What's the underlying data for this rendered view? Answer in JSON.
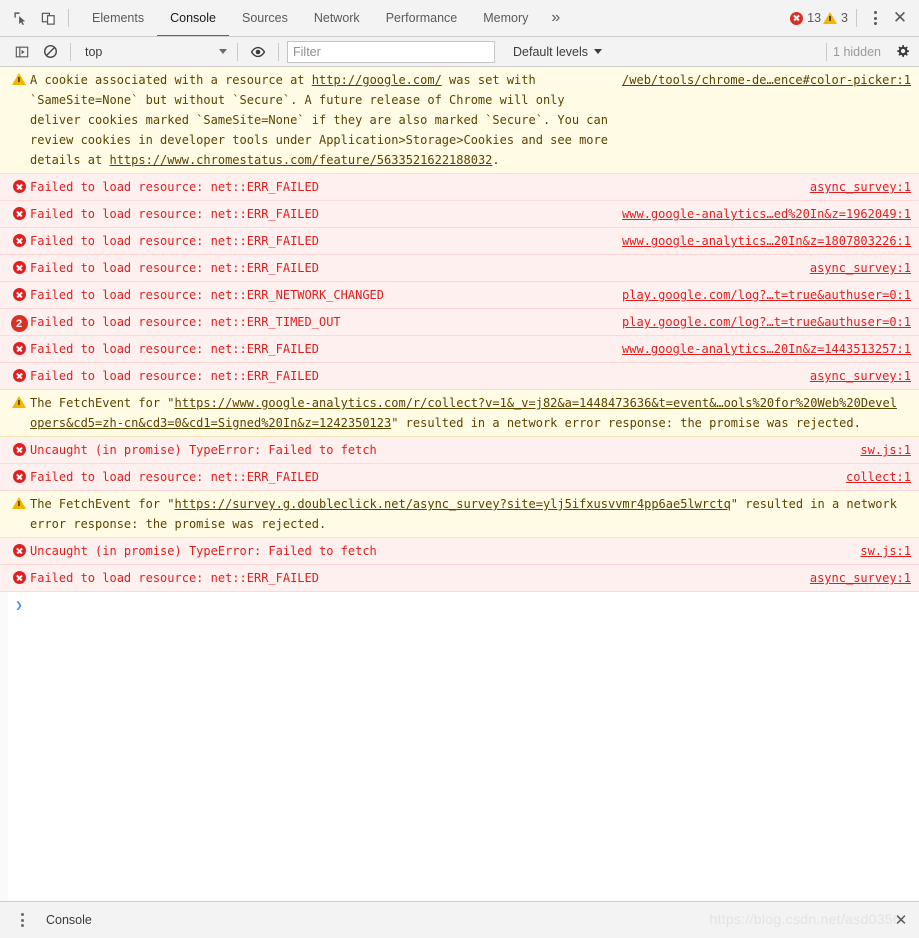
{
  "window": {
    "title": "Chrome DevTools — Console"
  },
  "tabbar": {
    "inspect_icon": "inspect-cursor-icon",
    "device_icon": "device-toolbar-icon",
    "tabs": [
      {
        "label": "Elements",
        "selected": false
      },
      {
        "label": "Console",
        "selected": true
      },
      {
        "label": "Sources",
        "selected": false
      },
      {
        "label": "Network",
        "selected": false
      },
      {
        "label": "Performance",
        "selected": false
      },
      {
        "label": "Memory",
        "selected": false
      }
    ],
    "more_tabs_label": "»",
    "error_count": "13",
    "warning_count": "3",
    "kebab_label": "customize-and-control",
    "close_label": "✕"
  },
  "toolbar": {
    "sidebar_toggle_icon": "console-sidebar-icon",
    "clear_icon": "clear-console-icon",
    "context": "top",
    "context_options": [
      "top"
    ],
    "eye_icon": "create-live-expression-icon",
    "filter_value": "",
    "filter_placeholder": "Filter",
    "levels_label": "Default levels",
    "hidden_label": "1 hidden",
    "settings_icon": "gear-icon"
  },
  "console": {
    "messages": [
      {
        "level": "warn",
        "icon": "warning-icon",
        "count": null,
        "text_parts": [
          {
            "t": "A cookie associated with a resource at ",
            "link": false
          },
          {
            "t": "http://google.com/",
            "link": true
          },
          {
            "t": " was set with `SameSite=None` but without `Secure`. A future release of Chrome will only deliver cookies marked `SameSite=None` if they are also marked `Secure`. You can review cookies in developer tools under Application>Storage>Cookies and see more details at ",
            "link": false
          },
          {
            "t": "https://www.chromestatus.com/feature/5633521622188032",
            "link": true
          },
          {
            "t": ".",
            "link": false
          }
        ],
        "source": "/web/tools/chrome-de…ence#color-picker:1"
      },
      {
        "level": "error",
        "icon": "error-icon",
        "count": null,
        "text_parts": [
          {
            "t": "Failed to load resource: net::ERR_FAILED",
            "link": false
          }
        ],
        "source": "async_survey:1"
      },
      {
        "level": "error",
        "icon": "error-icon",
        "count": null,
        "text_parts": [
          {
            "t": "Failed to load resource: net::ERR_FAILED",
            "link": false
          }
        ],
        "source": "www.google-analytics…ed%20In&z=1962049:1"
      },
      {
        "level": "error",
        "icon": "error-icon",
        "count": null,
        "text_parts": [
          {
            "t": "Failed to load resource: net::ERR_FAILED",
            "link": false
          }
        ],
        "source": "www.google-analytics…20In&z=1807803226:1"
      },
      {
        "level": "error",
        "icon": "error-icon",
        "count": null,
        "text_parts": [
          {
            "t": "Failed to load resource: net::ERR_FAILED",
            "link": false
          }
        ],
        "source": "async_survey:1"
      },
      {
        "level": "error",
        "icon": "error-icon",
        "count": null,
        "text_parts": [
          {
            "t": "Failed to load resource: net::ERR_NETWORK_CHANGED",
            "link": false
          }
        ],
        "source": "play.google.com/log?…t=true&authuser=0:1"
      },
      {
        "level": "error",
        "icon": "count-badge",
        "count": "2",
        "text_parts": [
          {
            "t": "Failed to load resource: net::ERR_TIMED_OUT",
            "link": false
          }
        ],
        "source": "play.google.com/log?…t=true&authuser=0:1"
      },
      {
        "level": "error",
        "icon": "error-icon",
        "count": null,
        "text_parts": [
          {
            "t": "Failed to load resource: net::ERR_FAILED",
            "link": false
          }
        ],
        "source": "www.google-analytics…20In&z=1443513257:1"
      },
      {
        "level": "error",
        "icon": "error-icon",
        "count": null,
        "text_parts": [
          {
            "t": "Failed to load resource: net::ERR_FAILED",
            "link": false
          }
        ],
        "source": "async_survey:1"
      },
      {
        "level": "warn",
        "icon": "warning-icon",
        "count": null,
        "text_parts": [
          {
            "t": "The FetchEvent for \"",
            "link": false
          },
          {
            "t": "https://www.google-analytics.com/r/collect?v=1&_v=j82&a=1448473636&t=event&…ools%20for%20Web%20Developers&cd5=zh-cn&cd3=0&cd1=Signed%20In&z=1242350123",
            "link": true
          },
          {
            "t": "\" resulted in a network error response: the promise was rejected.",
            "link": false
          }
        ],
        "source": ""
      },
      {
        "level": "error",
        "icon": "error-icon",
        "count": null,
        "text_parts": [
          {
            "t": "Uncaught (in promise) TypeError: Failed to fetch",
            "link": false
          }
        ],
        "source": "sw.js:1"
      },
      {
        "level": "error",
        "icon": "error-icon",
        "count": null,
        "text_parts": [
          {
            "t": "Failed to load resource: net::ERR_FAILED",
            "link": false
          }
        ],
        "source": "collect:1"
      },
      {
        "level": "warn",
        "icon": "warning-icon",
        "count": null,
        "text_parts": [
          {
            "t": "The FetchEvent for \"",
            "link": false
          },
          {
            "t": "https://survey.g.doubleclick.net/async_survey?site=ylj5ifxusvvmr4pp6ae5lwrctq",
            "link": true
          },
          {
            "t": "\" resulted in a network error response: the promise was rejected.",
            "link": false
          }
        ],
        "source": ""
      },
      {
        "level": "error",
        "icon": "error-icon",
        "count": null,
        "text_parts": [
          {
            "t": "Uncaught (in promise) TypeError: Failed to fetch",
            "link": false
          }
        ],
        "source": "sw.js:1"
      },
      {
        "level": "error",
        "icon": "error-icon",
        "count": null,
        "text_parts": [
          {
            "t": "Failed to load resource: net::ERR_FAILED",
            "link": false
          }
        ],
        "source": "async_survey:1"
      }
    ],
    "prompt_symbol": "❯",
    "prompt_value": ""
  },
  "drawer": {
    "kebab_label": "drawer-more-options",
    "tab_label": "Console",
    "watermark": "https://blog.csdn.net/asd0356",
    "close_label": "✕"
  },
  "colors": {
    "accent": "#1a73e8",
    "error": "#e02020",
    "error_bg": "#fff0f0",
    "warning": "#f2b600",
    "warning_bg": "#fffbe5",
    "toolbar_bg": "#f3f3f3"
  }
}
